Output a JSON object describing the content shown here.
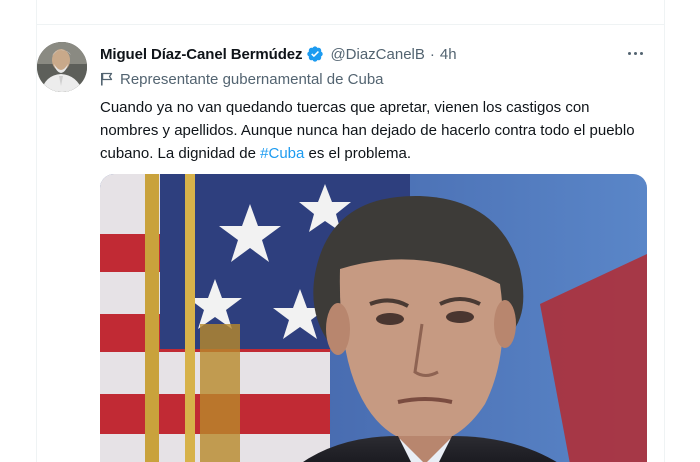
{
  "tweet": {
    "author_name": "Miguel Díaz-Canel Bermúdez",
    "handle": "@DiazCanelB",
    "separator": "·",
    "time": "4h",
    "label": "Representante gubernamental de Cuba",
    "text_before": "Cuando ya no van quedando tuercas que apretar, vienen los castigos con nombres y apellidos. Aunque nunca han dejado de hacerlo contra todo el pueblo cubano. La dignidad de ",
    "hashtag": "#Cuba",
    "text_after": " es el problema."
  },
  "icons": {
    "verified": "verified-badge-icon",
    "label": "government-flag-icon",
    "more": "more-options-icon"
  },
  "colors": {
    "primary_text": "#0f1419",
    "secondary_text": "#536471",
    "link": "#1d9bf0",
    "verified": "#1d9bf0",
    "divider": "#eff3f4"
  }
}
